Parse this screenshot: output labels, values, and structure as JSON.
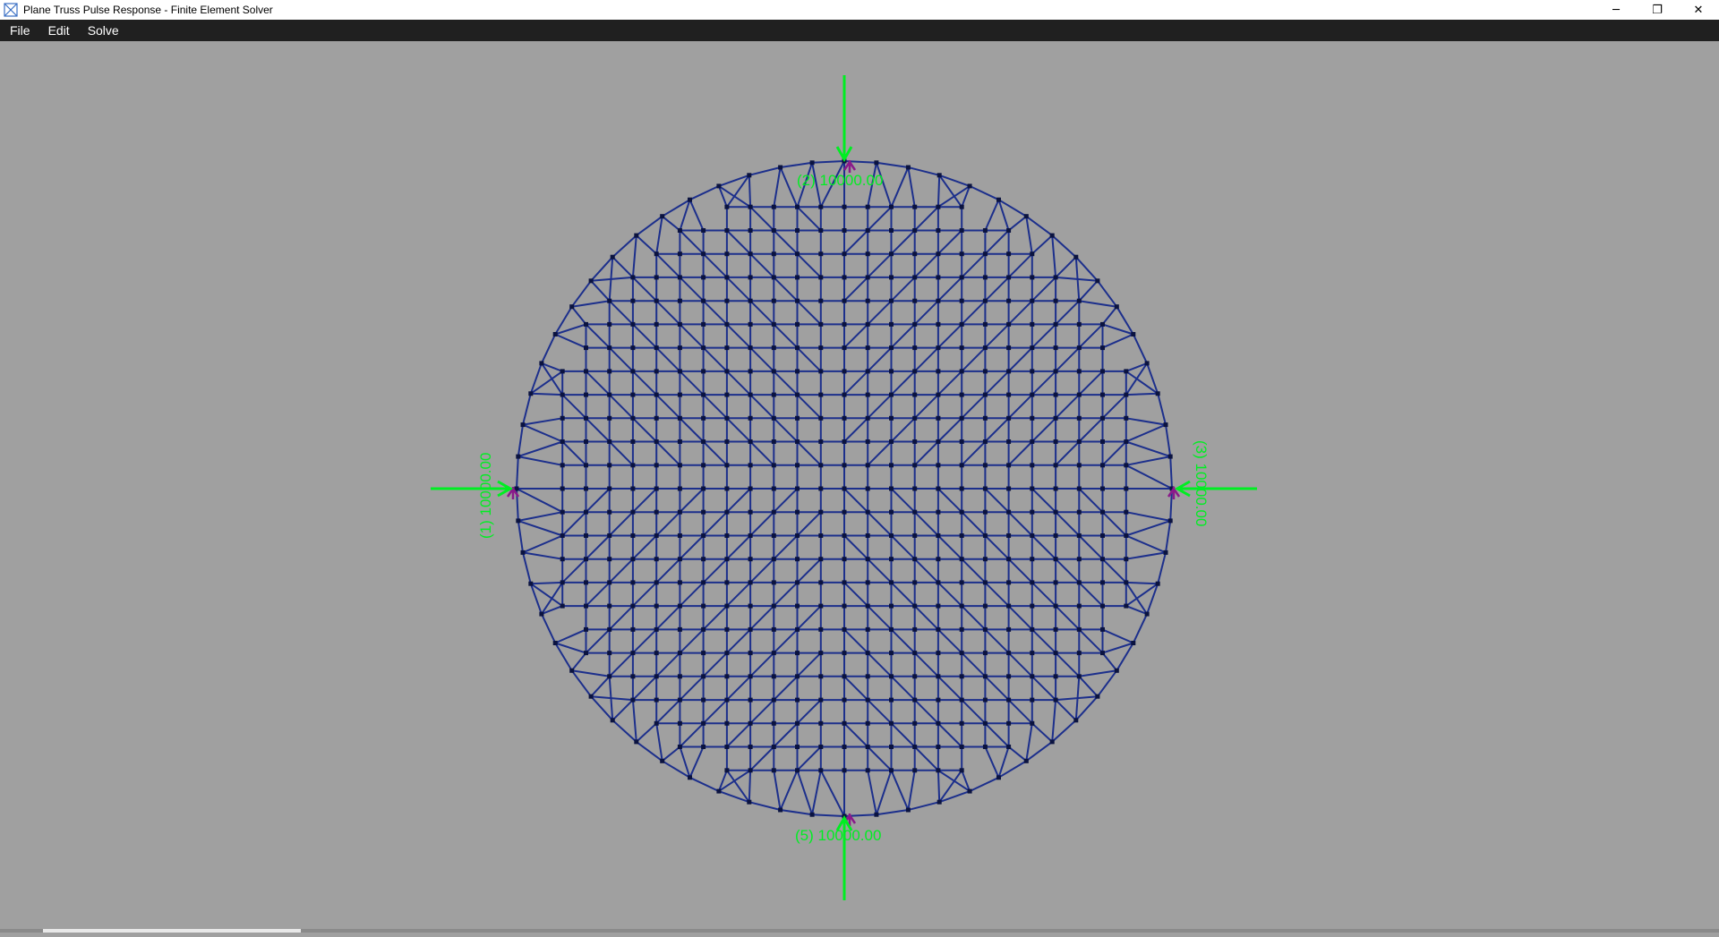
{
  "window": {
    "title": "Plane Truss Pulse Response - Finite Element Solver",
    "app_icon": "truss-app-icon",
    "controls": {
      "minimize": "─",
      "restore": "❐",
      "close": "✕"
    }
  },
  "menu": {
    "items": [
      {
        "label": "File"
      },
      {
        "label": "Edit"
      },
      {
        "label": "Solve"
      }
    ]
  },
  "canvas": {
    "background": "#a0a0a0",
    "truss_color": "#1c2f8c",
    "node_color": "#0b1340",
    "load_color": "#00ee22",
    "support_color": "#8a1a8a"
  },
  "model": {
    "grid_divisions": 12,
    "ring_nodes": 64
  },
  "loads": [
    {
      "id": "top",
      "label": "(2)  10000.00"
    },
    {
      "id": "bottom",
      "label": "(5)  10000.00"
    },
    {
      "id": "left",
      "label": "(1)  10000.00"
    },
    {
      "id": "right",
      "label": "(3)  10000.00"
    }
  ]
}
